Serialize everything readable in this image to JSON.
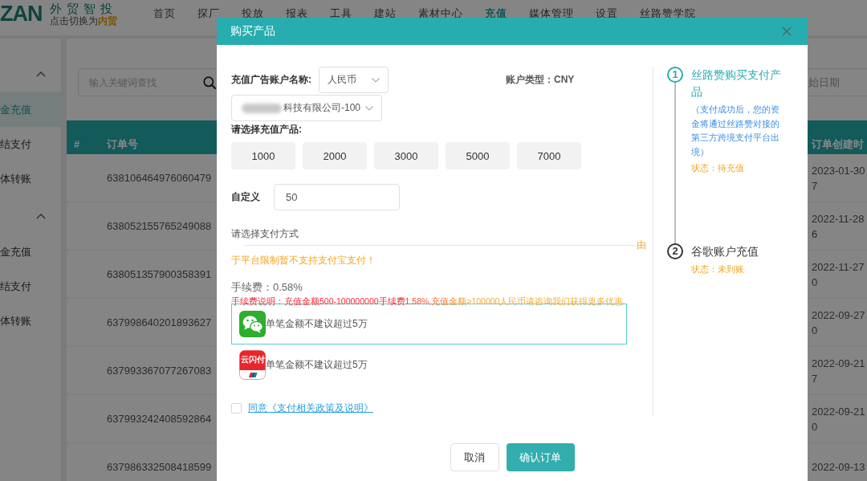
{
  "header": {
    "logo_letters": "ZAN",
    "brand": "外贸智投",
    "switch_link": "点击切换为**内贸**",
    "nav": [
      {
        "label": "首页",
        "selected": false
      },
      {
        "label": "探厂",
        "selected": false
      },
      {
        "label": "投放",
        "selected": false
      },
      {
        "label": "报表",
        "selected": false
      },
      {
        "label": "工具",
        "selected": false
      },
      {
        "label": "建站",
        "selected": false
      },
      {
        "label": "素材中心",
        "selected": false
      },
      {
        "label": "充值",
        "selected": true
      },
      {
        "label": "媒体管理",
        "selected": false
      },
      {
        "label": "设置",
        "selected": false
      },
      {
        "label": "丝路赞学院",
        "selected": false
      }
    ]
  },
  "sidebar": {
    "groups": [
      {
        "expanded": true,
        "items": [
          {
            "label": "金充值",
            "selected": true
          },
          {
            "label": "结支付",
            "selected": false
          },
          {
            "label": "体转账",
            "selected": false
          }
        ]
      },
      {
        "expanded": true,
        "items": [
          {
            "label": "金充值",
            "selected": false
          },
          {
            "label": "结支付",
            "selected": false
          },
          {
            "label": "体转账",
            "selected": false
          }
        ]
      }
    ]
  },
  "toolbar": {
    "search": {
      "placeholder": "输入关键词查找"
    },
    "date_field": {
      "placeholder": "始日期"
    }
  },
  "table": {
    "columns": [
      "#",
      "订单号",
      "订单创建时"
    ],
    "rows": [
      {
        "order_no": "638106464976060479",
        "created": [
          "2023-01-30",
          "7"
        ]
      },
      {
        "order_no": "638052155765249088",
        "created": [
          "2022-11-28",
          "6"
        ]
      },
      {
        "order_no": "638051357900358391",
        "created": [
          "2022-11-27",
          "0"
        ]
      },
      {
        "order_no": "637998640201893627",
        "created": [
          "2022-09-27",
          "0"
        ]
      },
      {
        "order_no": "637993367077267083",
        "created": [
          "2022-09-21",
          "7"
        ]
      },
      {
        "order_no": "637993242408592864",
        "created": [
          "2022-09-21",
          "0"
        ]
      },
      {
        "order_no": "637986332508418599",
        "created": [
          "2022-09-13"
        ]
      }
    ]
  },
  "dialog": {
    "title": "购买产品",
    "account_label": "充值广告账户名称:",
    "currency_select": {
      "value": "人民币"
    },
    "account_type": "账户类型：CNY",
    "account_select": {
      "value": "科技有限公司-100",
      "redacted": true
    },
    "product_label": "请选择充值产品:",
    "products": [
      {
        "label": "1000",
        "selected": false
      },
      {
        "label": "2000",
        "selected": false
      },
      {
        "label": "3000",
        "selected": false
      },
      {
        "label": "5000",
        "selected": false
      },
      {
        "label": "7000",
        "selected": false
      }
    ],
    "custom_label": "自定义",
    "custom_amount": {
      "value": "50"
    },
    "payment_label": "请选择支付方式",
    "notice": [
      "由",
      "于平台限制暂不支持支付宝支付！"
    ],
    "fee": "手续费：0.58%",
    "fee_note": "手续费说明：充值金额500-100000000手续费1.58%,充值金额>100000人民币请咨询我们获得更多优惠",
    "payment_methods": [
      {
        "kind": "wechat",
        "note": "单笔金额不建议超过5万",
        "selected": true
      },
      {
        "kind": "unionpay",
        "logo_text": "云闪付",
        "note": "单笔金额不建议超过5万",
        "selected": false
      }
    ],
    "agreement": {
      "checked": false,
      "link": "同意《支付相关政策及说明》"
    },
    "buttons": {
      "cancel": "取消",
      "confirm": "确认订单"
    },
    "steps": [
      {
        "number": "1",
        "title": "丝路赞购买支付产品",
        "description": "（支付成功后，您的资金将通过丝路赞对接的第三方跨境支付平台出境）",
        "status": "状态：待充值",
        "active": true
      },
      {
        "number": "2",
        "title": "谷歌账户充值",
        "status": "状态：未到账",
        "active": false
      }
    ]
  }
}
